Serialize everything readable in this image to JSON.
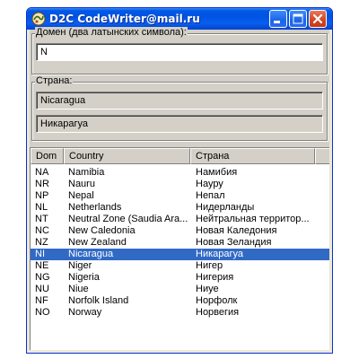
{
  "window": {
    "title": "D2C CodeWriter@mail.ru",
    "colors": {
      "titlebar": "#0058e6",
      "selection": "#316ac5",
      "client": "#d4d0c8"
    }
  },
  "domain_group": {
    "label": "Домен (два латынских символа):",
    "value": "N"
  },
  "country_group": {
    "label": "Страна:",
    "value_en": "Nicaragua",
    "value_ru": "Никарагуа"
  },
  "list": {
    "columns": [
      "Dom",
      "Country",
      "Страна"
    ],
    "selected_index": 8,
    "rows": [
      {
        "dom": "NA",
        "country": "Namibia",
        "strana": "Намибия"
      },
      {
        "dom": "NR",
        "country": "Nauru",
        "strana": "Науру"
      },
      {
        "dom": "NP",
        "country": "Nepal",
        "strana": "Непал"
      },
      {
        "dom": "NL",
        "country": "Netherlands",
        "strana": "Нидерланды"
      },
      {
        "dom": "NT",
        "country": "Neutral Zone (Saudia Ara...",
        "strana": "Нейтральная территор..."
      },
      {
        "dom": "NC",
        "country": "New Caledonia",
        "strana": "Новая Каледония"
      },
      {
        "dom": "NZ",
        "country": "New Zealand",
        "strana": "Новая Зеландия"
      },
      {
        "dom": "NI",
        "country": "Nicaragua",
        "strana": "Никарагуа"
      },
      {
        "dom": "NE",
        "country": "Niger",
        "strana": "Нигер"
      },
      {
        "dom": "NG",
        "country": "Nigeria",
        "strana": "Нигерия"
      },
      {
        "dom": "NU",
        "country": "Niue",
        "strana": "Ниуе"
      },
      {
        "dom": "NF",
        "country": "Norfolk Island",
        "strana": "Норфолк"
      },
      {
        "dom": "NO",
        "country": "Norway",
        "strana": "Норвегия"
      }
    ]
  }
}
